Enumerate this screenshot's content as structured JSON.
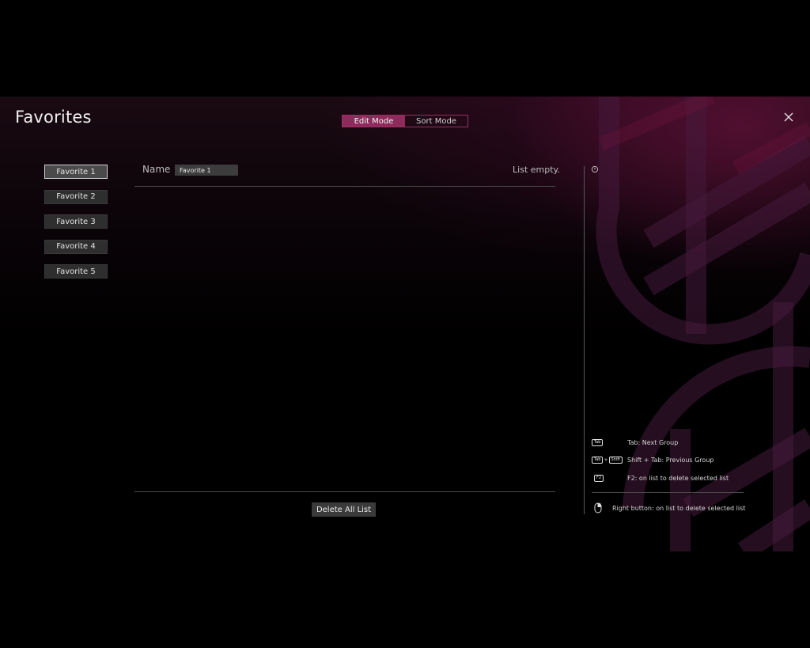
{
  "window": {
    "title": "Favorites",
    "close_icon": "close-icon"
  },
  "mode_toggle": {
    "edit_label": "Edit Mode",
    "sort_label": "Sort Mode",
    "active": "Edit Mode"
  },
  "favorites": {
    "items": [
      {
        "label": "Favorite 1",
        "selected": true
      },
      {
        "label": "Favorite 2",
        "selected": false
      },
      {
        "label": "Favorite 3",
        "selected": false
      },
      {
        "label": "Favorite 4",
        "selected": false
      },
      {
        "label": "Favorite 5",
        "selected": false
      }
    ]
  },
  "editor": {
    "name_label": "Name",
    "name_value": "Favorite 1",
    "list_status": "List empty.",
    "delete_all_label": "Delete All List"
  },
  "hints": {
    "info_icon": "info-icon",
    "items": [
      {
        "keys": [
          "Tab"
        ],
        "text": "Tab: Next Group"
      },
      {
        "keys": [
          "Tab",
          "Shift"
        ],
        "text": "Shift + Tab: Previous Group"
      },
      {
        "keys": [
          "F2"
        ],
        "text": "F2: on list to delete selected list"
      },
      {
        "icon": "mouse-icon",
        "text": "Right button: on list to delete selected list"
      }
    ],
    "plus_glyph": "+"
  },
  "colors": {
    "accent": "#8e2a5c",
    "accent_border": "#9a2e63",
    "button_bg": "#2e2e2e",
    "selected_border": "#d0d0d0"
  }
}
